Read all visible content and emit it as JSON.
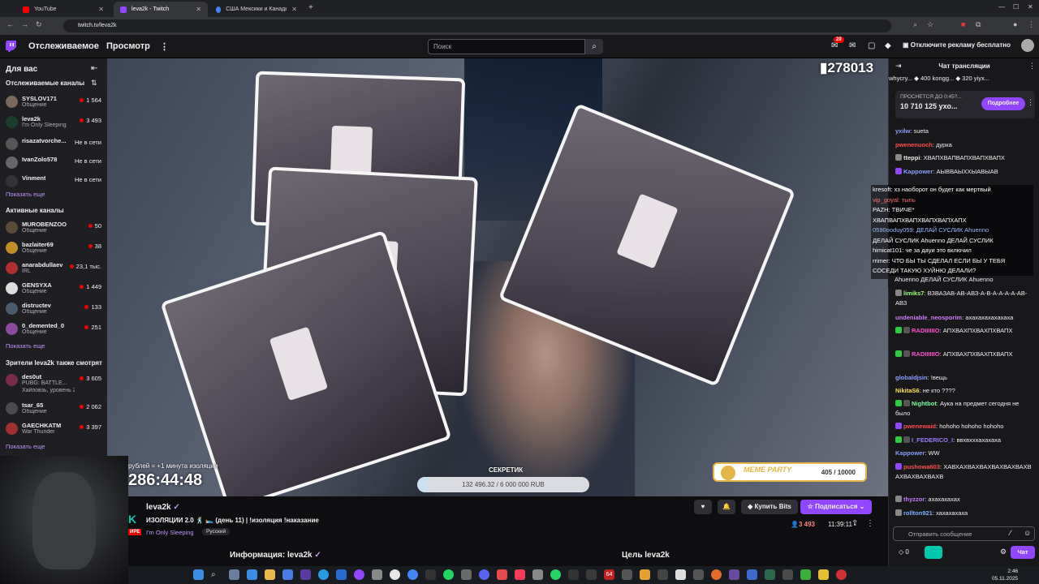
{
  "browser": {
    "tabs": [
      {
        "title": "YouTube",
        "color": "#ff0000"
      },
      {
        "title": "leva2k - Twitch",
        "color": "#9147ff"
      },
      {
        "title": "США Мексики и Канады - Пои",
        "color": "#4285f4"
      }
    ],
    "url": "twitch.tv/leva2k"
  },
  "topnav": {
    "following": "Отслеживаемое",
    "browse": "Просмотр",
    "search_placeholder": "Поиск",
    "notif_count": "20",
    "turbo": "Отключите рекламу бесплатно"
  },
  "sidebar": {
    "for_you": "Для вас",
    "followed_header": "Отслеживаемые каналы",
    "followed": [
      {
        "name": "SYSLOV171",
        "game": "Общение",
        "viewers": "1 564",
        "live": true,
        "color": "#7a6a5c"
      },
      {
        "name": "leva2k",
        "game": "I'm Only Sleeping",
        "viewers": "3 493",
        "live": true,
        "color": "#1a3d2e"
      },
      {
        "name": "risazatvorche...",
        "game": "",
        "viewers": "Не в сети",
        "live": false,
        "color": "#555"
      },
      {
        "name": "IvanZolo578",
        "game": "",
        "viewers": "Не в сети",
        "live": false,
        "color": "#666"
      },
      {
        "name": "Vinment",
        "game": "",
        "viewers": "Не в сети",
        "live": false,
        "color": "#333"
      }
    ],
    "show_more": "Показать еще",
    "active_header": "Активные каналы",
    "active": [
      {
        "name": "MUROBENZOO",
        "game": "Общение",
        "viewers": "50",
        "color": "#5a4a3a"
      },
      {
        "name": "bazlaiter69",
        "game": "Общение",
        "viewers": "38",
        "color": "#c28e2a"
      },
      {
        "name": "anarabdullaev",
        "game": "IRL",
        "viewers": "23,1 тыс.",
        "color": "#b03030"
      },
      {
        "name": "GENSYXA",
        "game": "Общение",
        "viewers": "1 449",
        "color": "#dddddd"
      },
      {
        "name": "distructev",
        "game": "Общение",
        "viewers": "133",
        "color": "#4a5a6a"
      },
      {
        "name": "0_demented_0",
        "game": "Общение",
        "viewers": "251",
        "color": "#8a4aa0"
      }
    ],
    "viewers_header": "Зрители leva2k также смотрят",
    "also": [
      {
        "name": "des0ut",
        "game": "PUBG: BATTLE...",
        "sub": "Хайповзь, уровень 2",
        "viewers": "3 605",
        "color": "#7a2a4a"
      },
      {
        "name": "tsar_65",
        "game": "Общение",
        "sub": "",
        "viewers": "2 062",
        "color": "#4a4a4a"
      },
      {
        "name": "GAECHKATM",
        "game": "War Thunder",
        "sub": "",
        "viewers": "3 397",
        "color": "#a03030"
      }
    ]
  },
  "player": {
    "viewer_overlay": "278013",
    "timer_label": "рублей = +1 минута изоляции",
    "timer": "286:44:48",
    "goal_title": "СЕКРЕТИК",
    "goal_text": "132 496.32 / 6 000 000 RUB",
    "goal_fraction": 0.022,
    "meme_title": "MEME PARTY",
    "meme_count": "405 / 10000"
  },
  "info": {
    "streamer": "leva2k",
    "title": "ИЗОЛЯЦИИ 2.0 🕺 🛌 (день 11) | !изоляция !наказание",
    "live": "ИРЕ",
    "category": "I'm Only Sleeping",
    "lang": "Русский",
    "bits": "Купить Bits",
    "subscribe": "Подписаться",
    "viewers": "3 493",
    "uptime": "11:39:11",
    "about": "Информация: leva2k",
    "goal": "Цель leva2k"
  },
  "chat": {
    "header": "Чат трансляции",
    "leaderboard": "whycry...  ◆ 400   kongg...  ◆ 320   yiyx...",
    "pin_top": "ПРОСНЕТСЯ ДО 0:45?...",
    "pin_value": "10 710 125 ухо...",
    "pin_button": "Подробнее",
    "messages": [
      {
        "user": "yxilw",
        "text": "sueta",
        "color": "#8a9dff"
      },
      {
        "user": "pwenenuoch",
        "text": "дурка",
        "color": "#ff4e4e"
      },
      {
        "user": "tteppi",
        "text": "ХВАПХВАПВАПХВАПХВАПХ",
        "color": "#e5e5e5"
      },
      {
        "user": "Kappower",
        "text": "АЫВВАЫХХЫАВЫАВ",
        "color": "#8a9dff"
      },
      {
        "user": "limiks7",
        "text": "ВЗВАЗАВ-АВ-АВЗ-А-В-А-А-А-А-АВ-АВЗ",
        "color": "#9aff7a"
      },
      {
        "user": "undeniable_neosporim",
        "text": "ахахахахахахаха",
        "color": "#d07aff"
      },
      {
        "user": "RADIIIIIIO",
        "text": "АПХВАХПХВАХПХВАПХ",
        "color": "#ff4ed0"
      },
      {
        "user": "RADIIIIIIO",
        "text": "АПХВАХПХВАХПХВАПХ",
        "color": "#ff4ed0"
      },
      {
        "user": "globaldjsin",
        "text": "!вещь",
        "color": "#8a9dff"
      },
      {
        "user": "NikitaS6",
        "text": "не кто ????",
        "color": "#ffe24e"
      },
      {
        "user": "Nightbot",
        "text": "Аука на предмет сегодня не было",
        "color": "#7aff9a"
      },
      {
        "user": "pwenewaid",
        "text": "hohoho hohoho hohoho",
        "color": "#ff4e4e"
      },
      {
        "user": "I_FEDERICO_I",
        "text": "ввхвхххахахаха",
        "color": "#9a7aff"
      },
      {
        "user": "Kappower",
        "text": "WW",
        "color": "#8a9dff"
      },
      {
        "user": "pushowa603",
        "text": "ХАВХАХВАХВАХВАХВАХВАХВАХВАХВАХВАХВ",
        "color": "#ff4e4e"
      },
      {
        "user": "thyzzor",
        "text": "ахахахахах",
        "color": "#c07aff"
      },
      {
        "user": "rollton921",
        "text": "хахахахаха",
        "color": "#7ab0ff"
      }
    ],
    "float_lines": [
      "kresoft: хз наоборот он будет как мертвый",
      "vip_goyal: тыnь",
      "РАZН: ТВИЧЕ*",
      "ХВАПВАПХВАПХВАПХВАПХАПХ",
      "0590ooduy059: ДЕЛАЙ СУСЛИК Ahuenno",
      "ДЕЛАЙ СУСЛИК Ahuenno ДЕЛАЙ СУСЛИК",
      "himicat101: че за дауи это включил",
      "rrimer: ЧТО БЫ ТЫ СДЕЛАЛ ЕСЛИ БЫ У ТЕБЯ",
      "СОСЕДИ ТАКУЮ ХУЙНЮ ДЕЛАЛИ?",
      "himicat101: Ahuenno ДЕЛАЙ СУСЛИК",
      "Ahuenno ДЕЛАЙ СУСЛИК Ahuenno"
    ],
    "input_placeholder": "Отправить сообщение",
    "points": "0",
    "send": "Чат"
  },
  "taskbar": {
    "time": "2:46",
    "date": "05.11.2025",
    "badge": "64"
  }
}
